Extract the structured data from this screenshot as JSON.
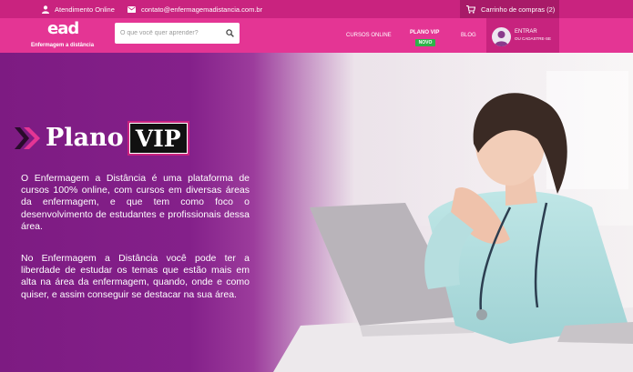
{
  "topbar": {
    "atendimento": "Atendimento Online",
    "email": "contato@enfermagemadistancia.com.br",
    "cart": "Carrinho de compras (2)"
  },
  "header": {
    "logo_mark": "ead",
    "logo_sub": "Enfermagem a distância",
    "search_placeholder": "O que você quer aprender?",
    "nav_cursos": "CURSOS ONLINE",
    "nav_vip": "PLANO VIP",
    "nav_vip_badge": "NOVO",
    "nav_blog": "BLOG",
    "entrar": "ENTRAR",
    "cadastre": "OU CADASTRE-SE"
  },
  "hero": {
    "title_plano": "Plano",
    "title_vip": "VIP",
    "paragraph_1": "O Enfermagem a Distância é uma plataforma de cursos 100% online, com cursos em diversas áreas da enfermagem, e que tem como foco o desenvolvimento de estudantes e profissionais dessa área.",
    "paragraph_2": "No Enfermagem a Distância você pode ter a liberdade de estudar os temas que estão mais em alta na área da enfermagem, quando, onde e como quiser, e assim conseguir se destacar na sua área."
  },
  "colors": {
    "topbar": "#c9237f",
    "header": "#e43594",
    "hero_purple": "#7d1b82",
    "badge_green": "#2db34a"
  },
  "icons": [
    "user-icon",
    "mail-icon",
    "cart-icon",
    "search-icon",
    "chevron-right-icon",
    "avatar-icon"
  ]
}
